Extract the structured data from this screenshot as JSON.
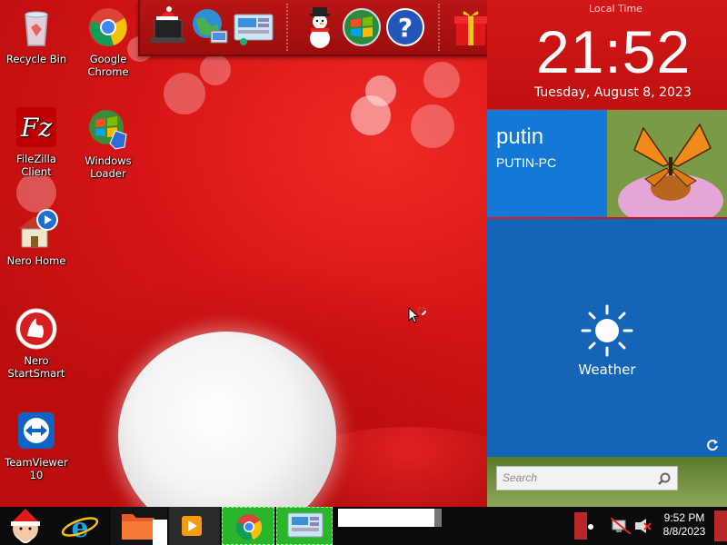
{
  "desktop": {
    "icons": [
      {
        "label": "Recycle Bin",
        "icon": "recycle-bin-icon"
      },
      {
        "label": "Google Chrome",
        "icon": "chrome-icon"
      },
      {
        "label": "FileZilla Client",
        "icon": "filezilla-icon"
      },
      {
        "label": "Windows Loader",
        "icon": "windows-loader-icon"
      },
      {
        "label": "Nero Home",
        "icon": "nero-home-icon"
      },
      {
        "label": "Nero StartSmart",
        "icon": "nero-startsmart-icon"
      },
      {
        "label": "TeamViewer 10",
        "icon": "teamviewer-icon"
      }
    ]
  },
  "dock": {
    "items": [
      "santa-laptop-icon",
      "globe-network-icon",
      "control-panel-icon",
      "snowman-icon",
      "windows-orb-icon",
      "help-icon",
      "gift-icon",
      "folder-icon",
      "recycle-bin-icon"
    ]
  },
  "clock": {
    "label": "Local Time",
    "time": "21:52",
    "date": "Tuesday, August 8, 2023"
  },
  "user": {
    "name": "putin",
    "pc": "PUTIN-PC"
  },
  "weather": {
    "label": "Weather"
  },
  "search": {
    "placeholder": "Search"
  },
  "taskbar": {
    "time": "9:52 PM",
    "date": "8/8/2023"
  },
  "colors": {
    "wallpaper_red": "#d81818",
    "user_tile": "#1479d6",
    "weather_tile": "#1464b8",
    "taskbar": "#0b0b0b"
  }
}
